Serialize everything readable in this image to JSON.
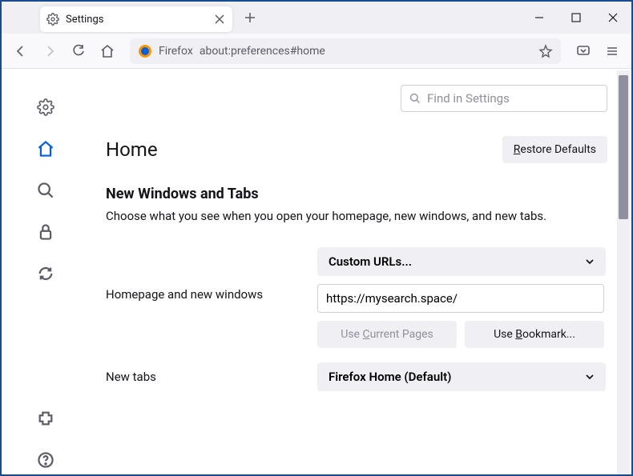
{
  "tab": {
    "title": "Settings"
  },
  "url": {
    "identity": "Firefox",
    "address": "about:preferences#home"
  },
  "search": {
    "placeholder": "Find in Settings"
  },
  "page": {
    "title": "Home",
    "restore": "Restore Defaults"
  },
  "section": {
    "title": "New Windows and Tabs",
    "desc": "Choose what you see when you open your homepage, new windows, and new tabs."
  },
  "rows": {
    "homepage": {
      "label": "Homepage and new windows",
      "dropdown": "Custom URLs...",
      "value": "https://mysearch.space/",
      "useCurrent": "Use Current Pages",
      "useBookmark": "Use Bookmark..."
    },
    "newtabs": {
      "label": "New tabs",
      "dropdown": "Firefox Home (Default)"
    }
  }
}
